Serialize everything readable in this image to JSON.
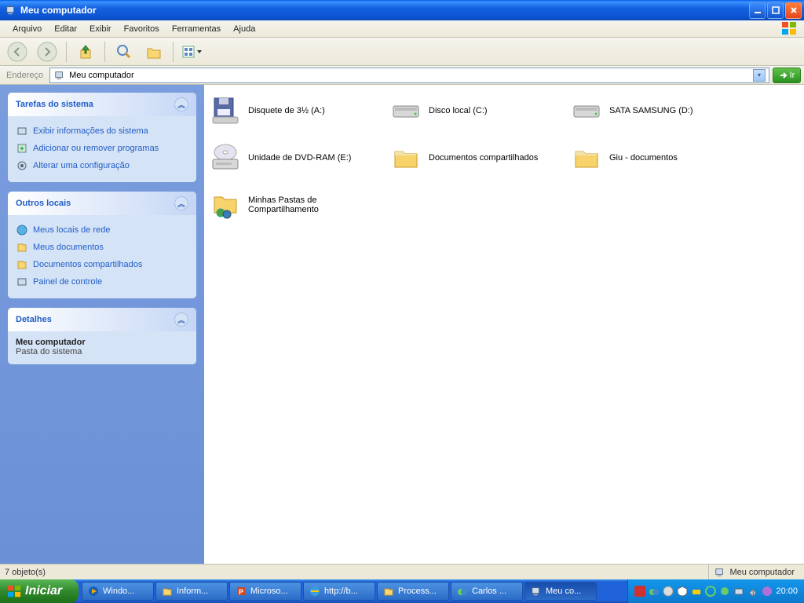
{
  "window": {
    "title": "Meu computador"
  },
  "menu": {
    "items": [
      "Arquivo",
      "Editar",
      "Exibir",
      "Favoritos",
      "Ferramentas",
      "Ajuda"
    ]
  },
  "address": {
    "label": "Endereço",
    "value": "Meu computador",
    "go": "Ir"
  },
  "sidebar": {
    "panels": [
      {
        "title": "Tarefas do sistema",
        "links": [
          {
            "icon": "info-icon",
            "label": "Exibir informações do sistema"
          },
          {
            "icon": "programs-icon",
            "label": "Adicionar ou remover programas"
          },
          {
            "icon": "settings-icon",
            "label": "Alterar uma configuração"
          }
        ]
      },
      {
        "title": "Outros locais",
        "links": [
          {
            "icon": "network-icon",
            "label": "Meus locais de rede"
          },
          {
            "icon": "docs-icon",
            "label": "Meus documentos"
          },
          {
            "icon": "shared-icon",
            "label": "Documentos compartilhados"
          },
          {
            "icon": "control-icon",
            "label": "Painel de controle"
          }
        ]
      },
      {
        "title": "Detalhes",
        "detail_title": "Meu computador",
        "detail_sub": "Pasta do sistema"
      }
    ]
  },
  "content": {
    "items": [
      {
        "icon": "floppy-icon",
        "label": "Disquete de 3½ (A:)"
      },
      {
        "icon": "hdd-icon",
        "label": "Disco local (C:)"
      },
      {
        "icon": "hdd-icon",
        "label": "SATA SAMSUNG (D:)"
      },
      {
        "icon": "dvd-icon",
        "label": "Unidade de DVD-RAM (E:)"
      },
      {
        "icon": "folder-icon",
        "label": "Documentos compartilhados"
      },
      {
        "icon": "folder-icon",
        "label": "Giu - documentos"
      },
      {
        "icon": "shared-folder-icon",
        "label": "Minhas Pastas de Compartilhamento"
      }
    ]
  },
  "statusbar": {
    "left": "7 objeto(s)",
    "right": "Meu computador"
  },
  "taskbar": {
    "start": "Iniciar",
    "buttons": [
      {
        "icon": "wmp-icon",
        "label": "Windo..."
      },
      {
        "icon": "folder-icon",
        "label": "Inform..."
      },
      {
        "icon": "ppt-icon",
        "label": "Microso..."
      },
      {
        "icon": "ie-icon",
        "label": "http://b..."
      },
      {
        "icon": "folder-icon",
        "label": "Process..."
      },
      {
        "icon": "msn-icon",
        "label": "Carlos ..."
      },
      {
        "icon": "computer-icon",
        "label": "Meu co...",
        "active": true
      }
    ],
    "clock": "20:00"
  }
}
